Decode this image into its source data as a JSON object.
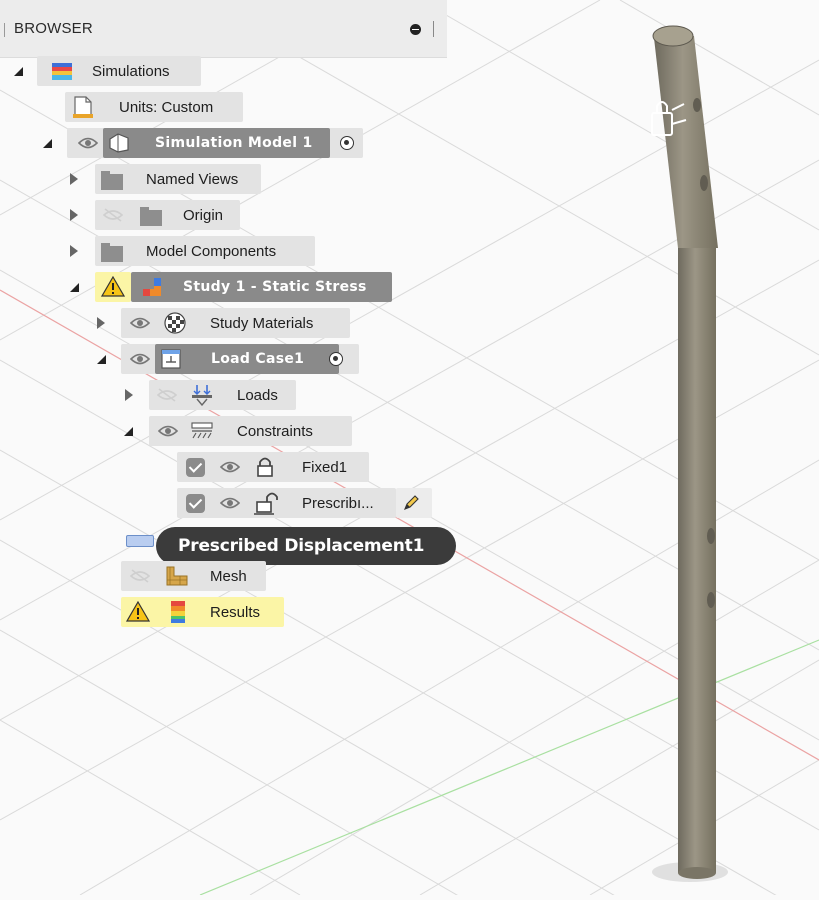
{
  "browser": {
    "title": "BROWSER",
    "tree": {
      "simulations": "Simulations",
      "units": "Units: Custom",
      "model": "Simulation Model 1",
      "named_views": "Named Views",
      "origin": "Origin",
      "model_components": "Model Components",
      "study": "Study 1 - Static Stress",
      "study_materials": "Study Materials",
      "load_case": "Load Case1",
      "loads": "Loads",
      "constraints": "Constraints",
      "fixed": "Fixed1",
      "prescribed": "Prescribı..."
    },
    "mesh": "Mesh",
    "results": "Results"
  },
  "tooltip": {
    "text": "Prescribed Displacement1"
  },
  "colors": {
    "header_bg": "#ececec",
    "row_pill": "#e3e3e3",
    "active_pill": "#8a8a8a",
    "warning_pill": "#fbf5a6",
    "tooltip_bg": "#3b3b3b",
    "rod": "#8e8877",
    "grid": "#dcdcdc",
    "red_axis": "#e89a9a",
    "green_axis": "#a9e3a1"
  },
  "icons": [
    "expand-triangle-icon",
    "collapse-triangle-icon",
    "simulation-icon",
    "units-document-icon",
    "eye-icon",
    "eye-hidden-icon",
    "component-icon",
    "folder-icon",
    "warning-icon",
    "study-icon",
    "materials-icon",
    "load-case-icon",
    "loads-icon",
    "constraints-icon",
    "lock-closed-icon",
    "lock-open-icon",
    "pencil-icon",
    "mesh-icon",
    "results-icon",
    "radio-active-icon",
    "checkbox-icon"
  ]
}
